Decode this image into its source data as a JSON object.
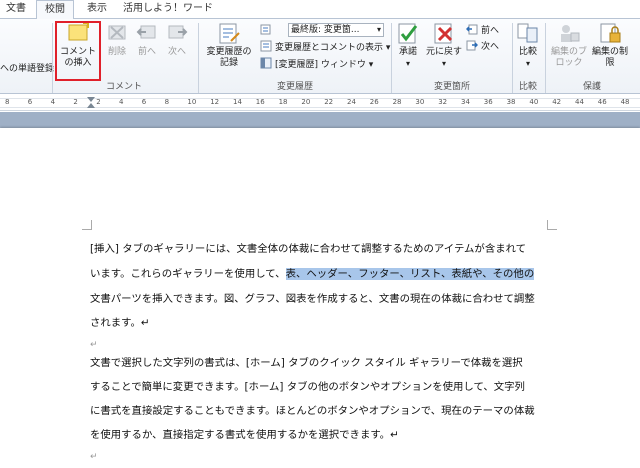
{
  "tabs": [
    {
      "label": "文書"
    },
    {
      "label": "校閲"
    },
    {
      "label": "表示"
    },
    {
      "label": "活用しよう！ワード"
    }
  ],
  "ribbon": {
    "partial_left_label": "への単語登録",
    "comment_group": {
      "label": "コメント",
      "insert": "コメントの挿入",
      "delete": "削除",
      "prev": "前へ",
      "next": "次へ"
    },
    "tracking_group": {
      "label": "変更履歴",
      "track_changes": "変更履歴の記録",
      "display_select": "最終版: 変更箇...",
      "show_markup": "変更履歴とコメントの表示",
      "reviewing_pane": "[変更履歴] ウィンドウ"
    },
    "changes_group": {
      "label": "変更箇所",
      "accept": "承諾",
      "reject": "元に戻す",
      "prev": "前へ",
      "next": "次へ"
    },
    "compare_group": {
      "label": "比較",
      "compare": "比較"
    },
    "protect_group": {
      "label": "保護",
      "block_authors": "編集のブロック",
      "restrict_editing": "編集の制限"
    }
  },
  "ruler": {
    "numbers": [
      "8",
      "6",
      "4",
      "2",
      "2",
      "4",
      "6",
      "8",
      "10",
      "12",
      "14",
      "16",
      "18",
      "20",
      "22",
      "24",
      "26",
      "28",
      "30",
      "32",
      "34",
      "36",
      "38",
      "40",
      "42",
      "44",
      "46",
      "48"
    ]
  },
  "document": {
    "lines": [
      {
        "text": "[挿入] タブのギャラリーには、文書全体の体裁に合わせて調整するためのアイテムが含まれて"
      },
      {
        "pre": "います。これらのギャラリーを使用して、",
        "sel": "表、ヘッダー、フッター、リスト、表紙や、その他の"
      },
      {
        "text": "文書パーツを挿入できます。図、グラフ、図表を作成すると、文書の現在の体裁に合わせて調整"
      },
      {
        "text": "されます。↵"
      },
      {
        "text": "↵"
      },
      {
        "text": "文書で選択した文字列の書式は、[ホーム] タブのクイック スタイル ギャラリーで体裁を選択"
      },
      {
        "text": "することで簡単に変更できます。[ホーム] タブの他のボタンやオプションを使用して、文字列"
      },
      {
        "text": "に書式を直接設定することもできます。ほとんどのボタンやオプションで、現在のテーマの体裁"
      },
      {
        "text": "を使用するか、直接指定する書式を使用するかを選択できます。↵"
      },
      {
        "text": "↵"
      }
    ]
  }
}
